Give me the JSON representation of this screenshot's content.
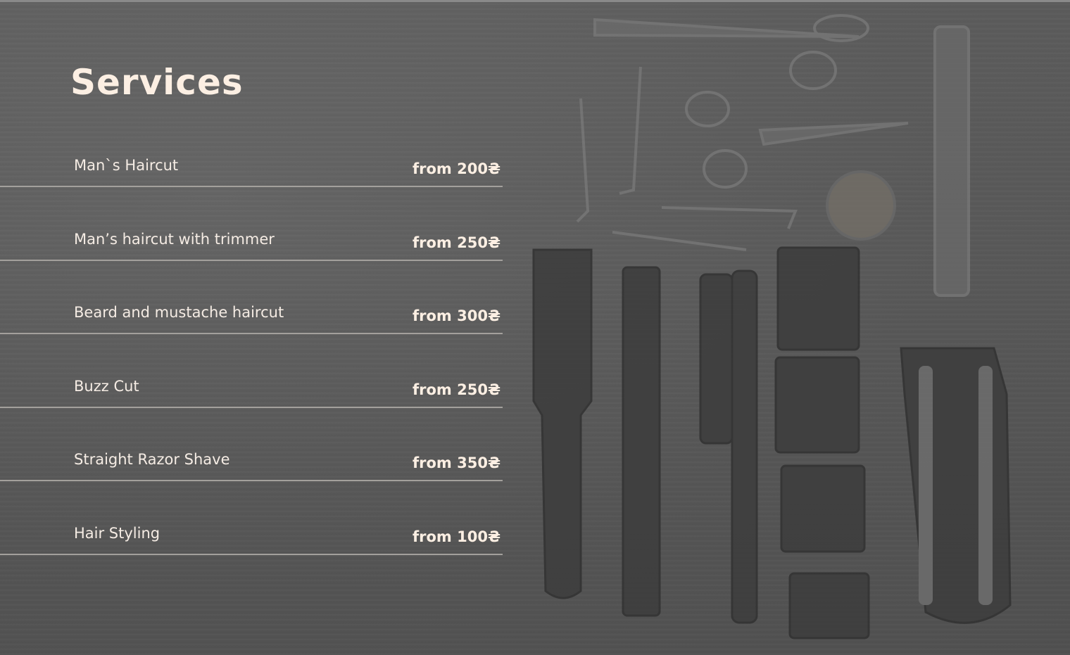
{
  "page": {
    "title": "Services"
  },
  "services": [
    {
      "name": "Man`s Haircut",
      "price": "from 200₴"
    },
    {
      "name": "Man’s haircut with trimmer",
      "price": "from 250₴"
    },
    {
      "name": "Beard and mustache haircut",
      "price": "from 300₴"
    },
    {
      "name": "Buzz Cut",
      "price": "from 250₴"
    },
    {
      "name": "Straight Razor Shave",
      "price": "from 350₴"
    },
    {
      "name": "Hair Styling",
      "price": "from 100₴"
    }
  ],
  "colors": {
    "background": "#5b5b5b",
    "text": "#f5ece4",
    "divider": "#a3a09c"
  },
  "background_image": {
    "icon": "barber-tools-icon"
  }
}
